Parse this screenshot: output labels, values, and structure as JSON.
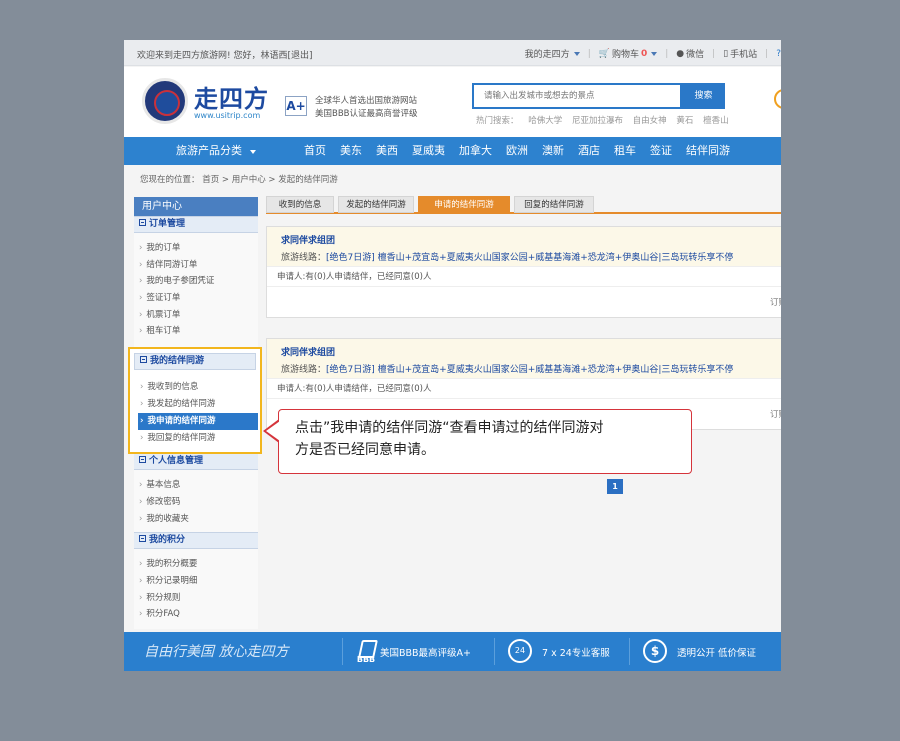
{
  "topbar": {
    "welcome": "欢迎来到走四方旅游网!",
    "greeting": "您好，林语西[退出]",
    "my_account": "我的走四方",
    "cart_label": "购物车",
    "cart_count": "0",
    "wechat": "微信",
    "mobile": "手机站"
  },
  "header": {
    "logo_text": "走四方",
    "logo_url_text": "www.usitrip.com",
    "rating": "A+",
    "bbb_line1": "全球华人首选出国旅游网站",
    "bbb_line2": "美国BBB认证最高商誉评级",
    "search_placeholder": "请输入出发城市或想去的景点",
    "search_button": "搜索",
    "hot_label": "热门搜索：",
    "hot_items": [
      "哈佛大学",
      "尼亚加拉瀑布",
      "自由女神",
      "黄石",
      "檀香山"
    ]
  },
  "nav": {
    "category_label": "旅游产品分类",
    "items": [
      "首页",
      "美东",
      "美西",
      "夏威夷",
      "加拿大",
      "欧洲",
      "澳新",
      "酒店",
      "租车",
      "签证",
      "结伴同游"
    ]
  },
  "breadcrumb": "您现在的位置： 首页 > 用户中心 > 发起的结伴同游",
  "sidebar": {
    "title": "用户中心",
    "orders": {
      "title": "订单管理",
      "items": [
        "我的订单",
        "结伴同游订单",
        "我的电子参团凭证",
        "签证订单",
        "机票订单",
        "租车订单"
      ]
    },
    "companion": {
      "title": "我的结伴同游",
      "items": [
        "我收到的信息",
        "我发起的结伴同游",
        "我申请的结伴同游",
        "我回复的结伴同游"
      ]
    },
    "profile": {
      "title": "个人信息管理",
      "items": [
        "基本信息",
        "修改密码",
        "我的收藏夹"
      ]
    },
    "points": {
      "title": "我的积分",
      "items": [
        "我的积分概要",
        "积分记录明细",
        "积分规则",
        "积分FAQ"
      ]
    }
  },
  "tabs": [
    "收到的信息",
    "发起的结伴同游",
    "申请的结伴同游",
    "回复的结伴同游"
  ],
  "cards": [
    {
      "title": "求同伴求组团",
      "route_label": "旅游线路：",
      "route": "[绝色7日游] 檀香山+茂宜岛+夏威夷火山国家公园+威基基海滩+恐龙湾+伊奥山谷|三岛玩转乐享不停",
      "requests": "申请人:有(0)人申请结伴，已经同意(0)人",
      "right_text": "订购"
    },
    {
      "title": "求同伴求组团",
      "route_label": "旅游线路：",
      "route": "[绝色7日游] 檀香山+茂宜岛+夏威夷火山国家公园+威基基海滩+恐龙湾+伊奥山谷|三岛玩转乐享不停",
      "requests": "申请人:有(0)人申请结伴，已经同意(0)人",
      "right_text": "订购"
    }
  ],
  "pagination": {
    "current": "1"
  },
  "callout": {
    "line1": "点击”我申请的结伴同游“查看申请过的结伴同游对",
    "line2": "方是否已经同意申请。"
  },
  "footer": {
    "slogan": "自由行美国 放心走四方",
    "bbb_icon_label": "BBB",
    "bbb_text": "美国BBB最高评级A+",
    "phone_icon_label": "24",
    "service": "7 x 24专业客服",
    "dollar_icon_label": "$",
    "price": "透明公开 低价保证"
  },
  "colors": {
    "nav_blue": "#2d82cf",
    "tab_orange": "#e58b2b",
    "highlight_yellow": "#f2b61e",
    "callout_red": "#d5343b"
  }
}
